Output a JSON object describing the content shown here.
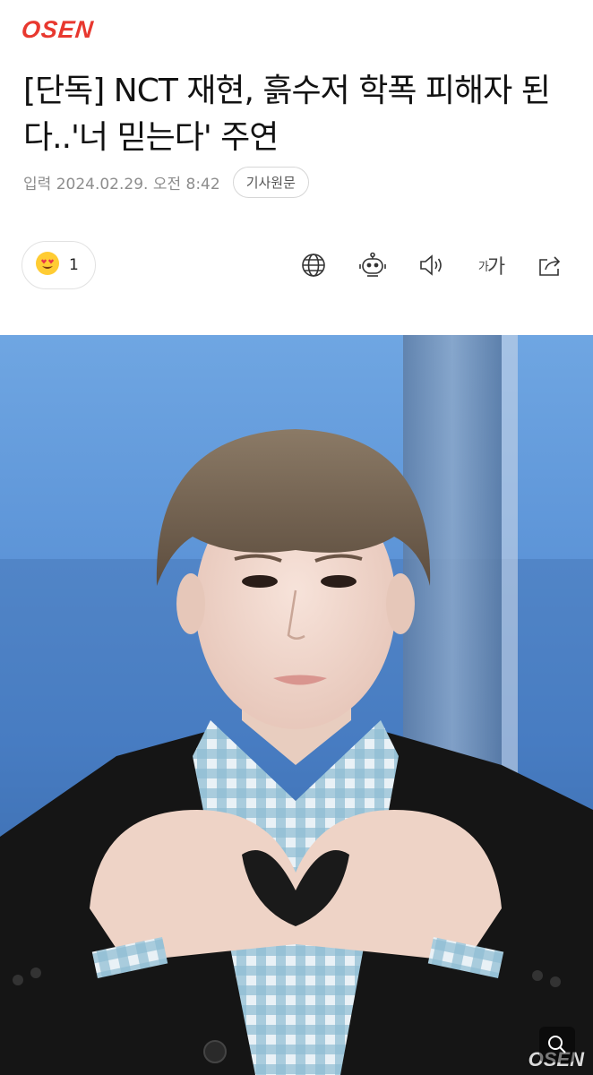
{
  "brand": {
    "logo_text": "OSEN",
    "color": "#e8382f"
  },
  "article": {
    "headline": "[단독] NCT 재현, 흙수저 학폭 피해자 된다..'너 믿는다' 주연",
    "meta_label": "입력",
    "published": "2024.02.29. 오전 8:42",
    "source_button": "기사원문"
  },
  "toolbar": {
    "reaction_emoji": "heart-eyes-emoji",
    "reaction_count": "1",
    "icons": [
      "globe-icon",
      "robot-summary-icon",
      "speaker-icon",
      "font-size-icon",
      "share-icon"
    ],
    "font_small": "가",
    "font_large": "가"
  },
  "photo": {
    "watermark": "OSEN",
    "zoom_icon": "zoom-icon"
  }
}
